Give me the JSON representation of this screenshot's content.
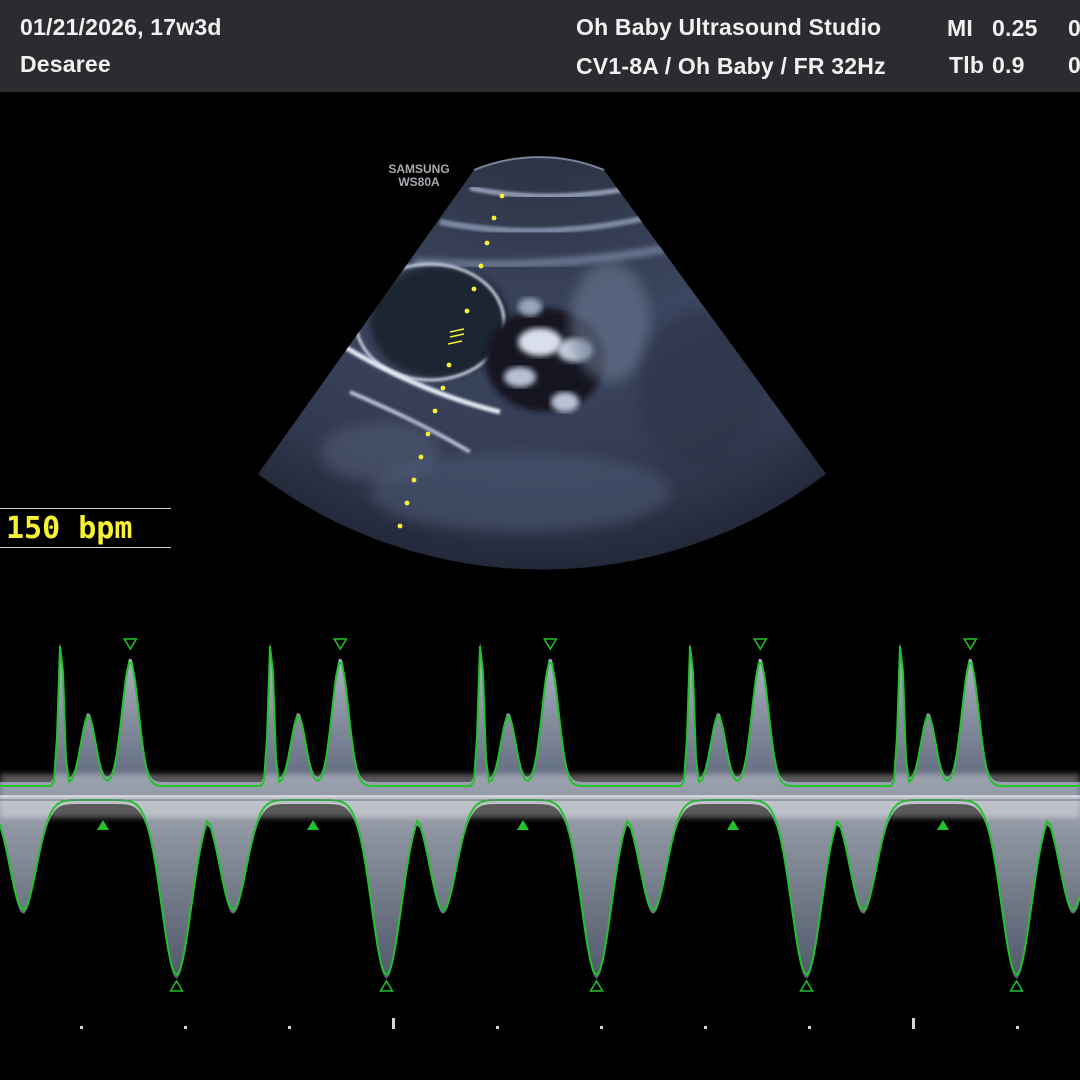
{
  "header": {
    "date_ga": "01/21/2026, 17w3d",
    "patient": "Desaree",
    "studio": "Oh Baby Ultrasound Studio",
    "probe_preset": "CV1-8A / Oh Baby / FR 32Hz",
    "mi_label": "MI",
    "mi_value": "0.25",
    "tib_label": "Tlb",
    "tib_value": "0.9",
    "mi_cut": "0",
    "tib_cut": "0"
  },
  "brand": {
    "line1": "SAMSUNG",
    "line2": "WS80A"
  },
  "measurement": {
    "heart_rate": "150 bpm"
  },
  "colors": {
    "header_bg": "#2a2c30",
    "trace_green": "#22c22a",
    "caliper_yellow": "#f7f334",
    "doppler_tint": "#c9d6ee"
  },
  "doppler": {
    "heart_rate_bpm": 150,
    "cycles_visible": 5
  }
}
